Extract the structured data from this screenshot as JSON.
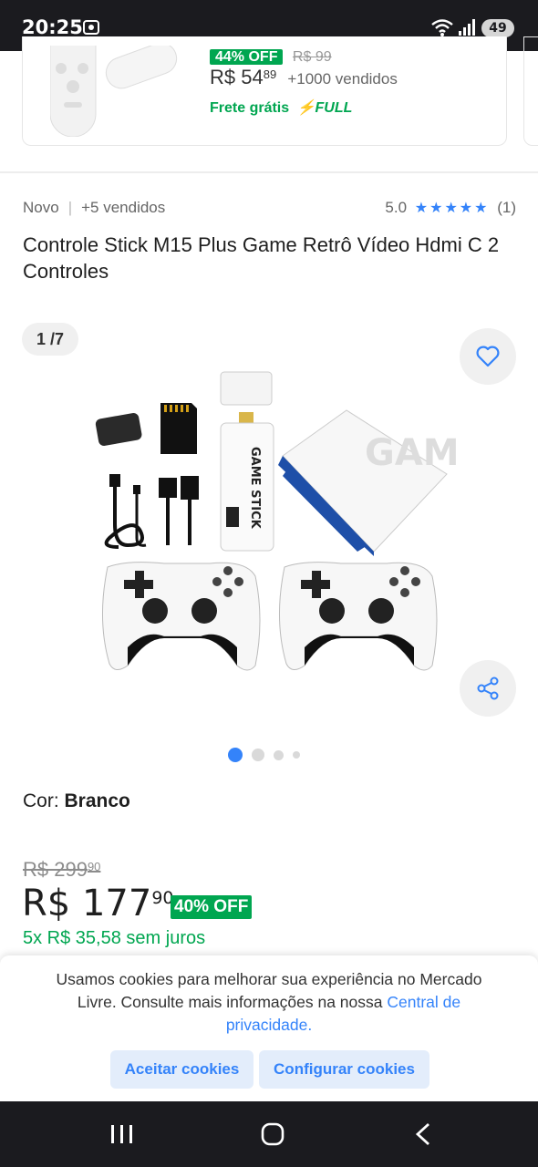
{
  "status_bar": {
    "time": "20:25",
    "battery": "49",
    "icons": [
      "screen-record-icon",
      "wifi-icon",
      "signal-icon",
      "battery-icon"
    ]
  },
  "top_card": {
    "discount_badge": "44% OFF",
    "old_price": "R$ 99",
    "price_main": "R$ 54",
    "price_cents": "89",
    "sold": "+1000 vendidos",
    "shipping": "Frete grátis",
    "shipping_badge": "FULL"
  },
  "product": {
    "condition": "Novo",
    "sold": "+5 vendidos",
    "rating": "5.0",
    "stars": "★★★★★",
    "review_count": "(1)",
    "title": "Controle Stick M15 Plus Game Retrô Vídeo Hdmi C 2 Controles",
    "image_counter": "1 /7",
    "color_label": "Cor: ",
    "color_value": "Branco",
    "old_price_main": "R$ 299",
    "old_price_cents": "90",
    "price_main": "R$ 177",
    "price_cents": "90",
    "off_badge": "40% OFF",
    "installments": "5x R$ 35,58 sem juros"
  },
  "cookies": {
    "text": "Usamos cookies para melhorar sua experiência no Mercado Livre. Consulte mais informações na nossa ",
    "link": "Central de privacidade",
    "link_suffix": ".",
    "accept_label": "Aceitar cookies",
    "config_label": "Configurar cookies"
  },
  "colors": {
    "accent": "#3483fa",
    "green": "#00a650",
    "status_bar": "#1b1b1f"
  }
}
